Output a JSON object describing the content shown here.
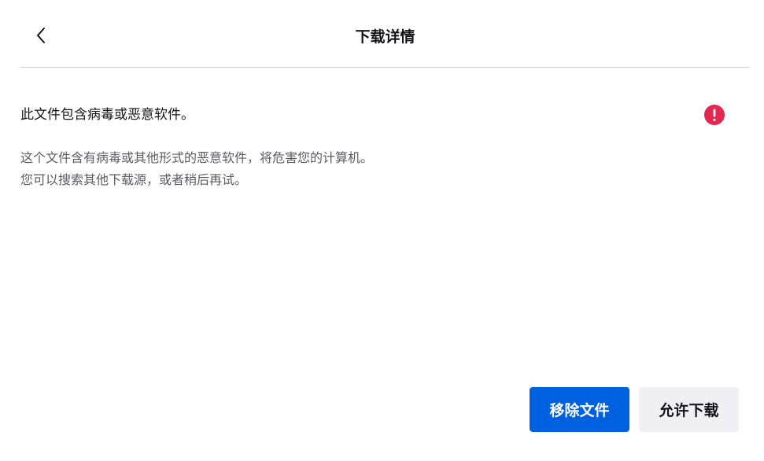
{
  "header": {
    "title": "下载详情",
    "back_icon": "chevron-left-icon"
  },
  "status": {
    "message": "此文件包含病毒或恶意软件。",
    "icon": "error-exclamation-icon",
    "icon_color": "#e22850"
  },
  "description": {
    "line1": "这个文件含有病毒或其他形式的恶意软件，将危害您的计算机。",
    "line2": "您可以搜索其他下载源，或者稍后再试。"
  },
  "actions": {
    "remove_label": "移除文件",
    "allow_label": "允许下载"
  },
  "colors": {
    "primary": "#0061e0",
    "secondary_bg": "#f0f0f4",
    "text": "#15141a",
    "muted_text": "#5b5b66",
    "divider": "#cfcfd8"
  }
}
